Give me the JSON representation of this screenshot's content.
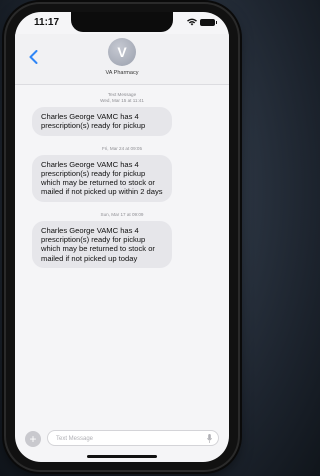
{
  "status_bar": {
    "time": "11:17"
  },
  "header": {
    "back_icon": "chevron-left-icon",
    "avatar_letter": "V",
    "contact_name": "VA Pharmacy"
  },
  "messages": [
    {
      "timestamp": "Text Message\nWed, Mar 15 at 11:41",
      "text": "Charles George VAMC has 4 prescription(s) ready for pickup"
    },
    {
      "timestamp": "Fri, Mar 24 at 09:05",
      "text": "Charles George VAMC has 4 prescription(s) ready for pickup which may be returned to stock or mailed if not picked up within 2 days"
    },
    {
      "timestamp": "Sun, Mar 17 at 09:09",
      "text": "Charles George VAMC has 4 prescription(s) ready for pickup which may be returned to stock or mailed if not picked up today"
    }
  ],
  "compose": {
    "placeholder": "Text Message"
  },
  "colors": {
    "accent": "#2f86f6",
    "bubble": "#e6e6ea"
  }
}
